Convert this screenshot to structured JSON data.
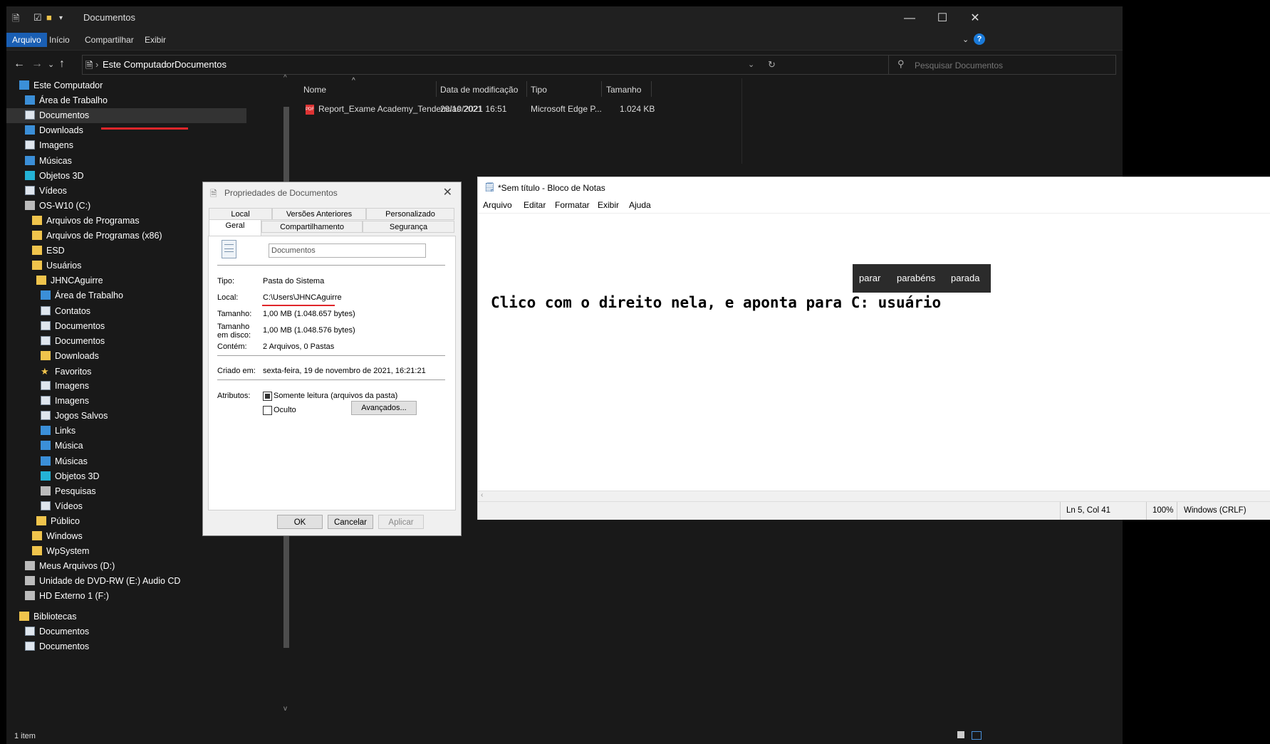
{
  "explorer": {
    "title": "Documentos",
    "ribbon_tabs": [
      "Arquivo",
      "Início",
      "Compartilhar",
      "Exibir"
    ],
    "breadcrumb": [
      "Este Computador",
      "Documentos"
    ],
    "search_placeholder": "Pesquisar Documentos",
    "nav": [
      {
        "label": "Este Computador",
        "icon": "computer-icon"
      },
      {
        "label": "Área de Trabalho",
        "icon": "desktop-icon"
      },
      {
        "label": "Documentos",
        "icon": "documents-icon",
        "selected": true
      },
      {
        "label": "Downloads",
        "icon": "download-icon"
      },
      {
        "label": "Imagens",
        "icon": "pictures-icon"
      },
      {
        "label": "Músicas",
        "icon": "music-icon"
      },
      {
        "label": "Objetos 3D",
        "icon": "objects-3d-icon"
      },
      {
        "label": "Vídeos",
        "icon": "videos-icon"
      },
      {
        "label": "OS-W10 (C:)",
        "icon": "drive-icon"
      },
      {
        "label": "Arquivos de Programas",
        "icon": "folder-icon"
      },
      {
        "label": "Arquivos de Programas (x86)",
        "icon": "folder-icon"
      },
      {
        "label": "ESD",
        "icon": "folder-icon"
      },
      {
        "label": "Usuários",
        "icon": "folder-icon"
      },
      {
        "label": "JHNCAguirre",
        "icon": "folder-icon"
      },
      {
        "label": "Área de Trabalho",
        "icon": "desktop-icon"
      },
      {
        "label": "Contatos",
        "icon": "contacts-icon"
      },
      {
        "label": "Documentos",
        "icon": "documents-icon"
      },
      {
        "label": "Documentos",
        "icon": "documents-icon"
      },
      {
        "label": "Downloads",
        "icon": "folder-icon"
      },
      {
        "label": "Favoritos",
        "icon": "star-icon"
      },
      {
        "label": "Imagens",
        "icon": "pictures-icon"
      },
      {
        "label": "Imagens",
        "icon": "pictures-icon"
      },
      {
        "label": "Jogos Salvos",
        "icon": "games-icon"
      },
      {
        "label": "Links",
        "icon": "link-icon"
      },
      {
        "label": "Música",
        "icon": "music-icon"
      },
      {
        "label": "Músicas",
        "icon": "music-icon"
      },
      {
        "label": "Objetos 3D",
        "icon": "objects-3d-icon"
      },
      {
        "label": "Pesquisas",
        "icon": "search-icon"
      },
      {
        "label": "Vídeos",
        "icon": "videos-icon"
      },
      {
        "label": "Público",
        "icon": "folder-icon"
      },
      {
        "label": "Windows",
        "icon": "folder-icon"
      },
      {
        "label": "WpSystem",
        "icon": "folder-icon"
      },
      {
        "label": "Meus Arquivos (D:)",
        "icon": "drive-icon"
      },
      {
        "label": "Unidade de DVD-RW (E:) Audio CD",
        "icon": "dvd-icon"
      },
      {
        "label": "HD Externo 1 (F:)",
        "icon": "drive-icon"
      },
      {
        "label": "Bibliotecas",
        "icon": "libraries-icon"
      },
      {
        "label": "Documentos",
        "icon": "documents-icon"
      },
      {
        "label": "Documentos",
        "icon": "documents-icon"
      }
    ],
    "columns": [
      "Nome",
      "Data de modificação",
      "Tipo",
      "Tamanho"
    ],
    "files": [
      {
        "name": "Report_Exame Academy_Tendencias 2021",
        "modified": "29/10/2021 16:51",
        "type": "Microsoft Edge P...",
        "size": "1.024 KB"
      }
    ],
    "status": "1 item"
  },
  "properties": {
    "title": "Propriedades de Documentos",
    "tabs_row1": [
      "Local",
      "Versões Anteriores",
      "Personalizado"
    ],
    "tabs_row2": [
      "Geral",
      "Compartilhamento",
      "Segurança"
    ],
    "name_value": "Documentos",
    "labels": {
      "tipo": "Tipo:",
      "local": "Local:",
      "tamanho": "Tamanho:",
      "tamanho_disco": "Tamanho em disco:",
      "contem": "Contém:",
      "criado": "Criado em:",
      "atributos": "Atributos:"
    },
    "values": {
      "tipo": "Pasta do Sistema",
      "local": "C:\\Users\\JHNCAguirre",
      "tamanho": "1,00 MB (1.048.657 bytes)",
      "tamanho_disco": "1,00 MB (1.048.576 bytes)",
      "contem": "2 Arquivos, 0 Pastas",
      "criado": "sexta-feira, 19 de novembro de 2021, 16:21:21"
    },
    "readonly_label": "Somente leitura (arquivos da pasta)",
    "hidden_label": "Oculto",
    "advanced_label": "Avançados...",
    "ok": "OK",
    "cancel": "Cancelar",
    "apply": "Aplicar"
  },
  "notepad": {
    "title": "*Sem título - Bloco de Notas",
    "menu": [
      "Arquivo",
      "Editar",
      "Formatar",
      "Exibir",
      "Ajuda"
    ],
    "text": "Clico com o direito nela, e aponta para C: usuário",
    "suggestions": [
      "parar",
      "parabéns",
      "parada"
    ],
    "status": {
      "position": "Ln 5, Col 41",
      "zoom": "100%",
      "encoding": "Windows (CRLF)"
    }
  }
}
